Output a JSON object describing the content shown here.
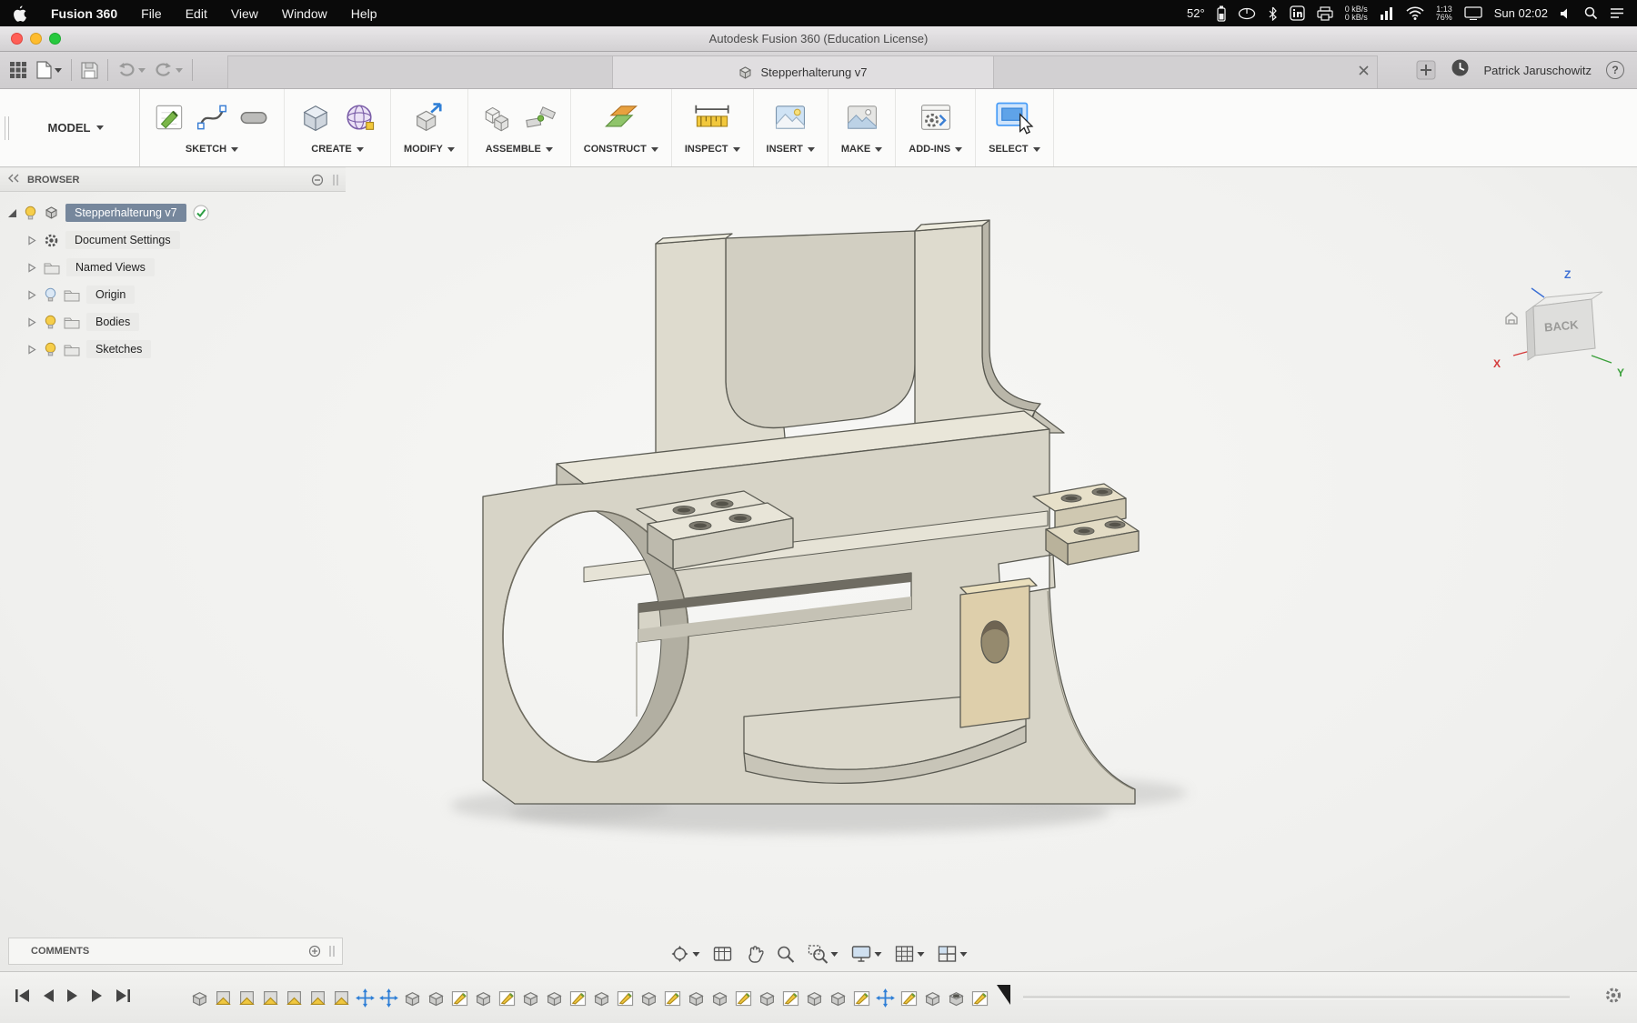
{
  "menubar": {
    "app_name": "Fusion 360",
    "items": [
      "File",
      "Edit",
      "View",
      "Window",
      "Help"
    ],
    "status": {
      "temp": "52°",
      "net_up": "0 kB/s",
      "net_down": "0 kB/s",
      "time_left": "1:13",
      "battery_pct": "76%",
      "clock": "Sun 02:02"
    }
  },
  "titlebar": {
    "title": "Autodesk Fusion 360 (Education License)"
  },
  "tabbar": {
    "doc_tab": "Stepperhalterung v7",
    "user": "Patrick Jaruschowitz",
    "help_label": "?"
  },
  "ribbon": {
    "workspace": "MODEL",
    "groups": [
      {
        "label": "SKETCH"
      },
      {
        "label": "CREATE"
      },
      {
        "label": "MODIFY"
      },
      {
        "label": "ASSEMBLE"
      },
      {
        "label": "CONSTRUCT"
      },
      {
        "label": "INSPECT"
      },
      {
        "label": "INSERT"
      },
      {
        "label": "MAKE"
      },
      {
        "label": "ADD-INS"
      },
      {
        "label": "SELECT"
      }
    ]
  },
  "browser": {
    "title": "BROWSER",
    "root": "Stepperhalterung v7",
    "items": [
      "Document Settings",
      "Named Views",
      "Origin",
      "Bodies",
      "Sketches"
    ]
  },
  "viewcube": {
    "face": "BACK",
    "axes": {
      "x": "X",
      "y": "Y",
      "z": "Z"
    }
  },
  "comments": {
    "label": "COMMENTS"
  },
  "timeline": {
    "features": [
      "extrude",
      "plane",
      "plane",
      "plane",
      "plane",
      "plane",
      "plane",
      "move",
      "move",
      "extrude",
      "extrude",
      "sketch",
      "extrude",
      "sketch",
      "extrude",
      "extrude",
      "sketch",
      "extrude",
      "sketch",
      "extrude",
      "sketch",
      "extrude",
      "extrude",
      "sketch",
      "extrude",
      "sketch",
      "extrude",
      "extrude",
      "sketch",
      "move",
      "sketch",
      "extrude",
      "hole",
      "sketch"
    ]
  }
}
